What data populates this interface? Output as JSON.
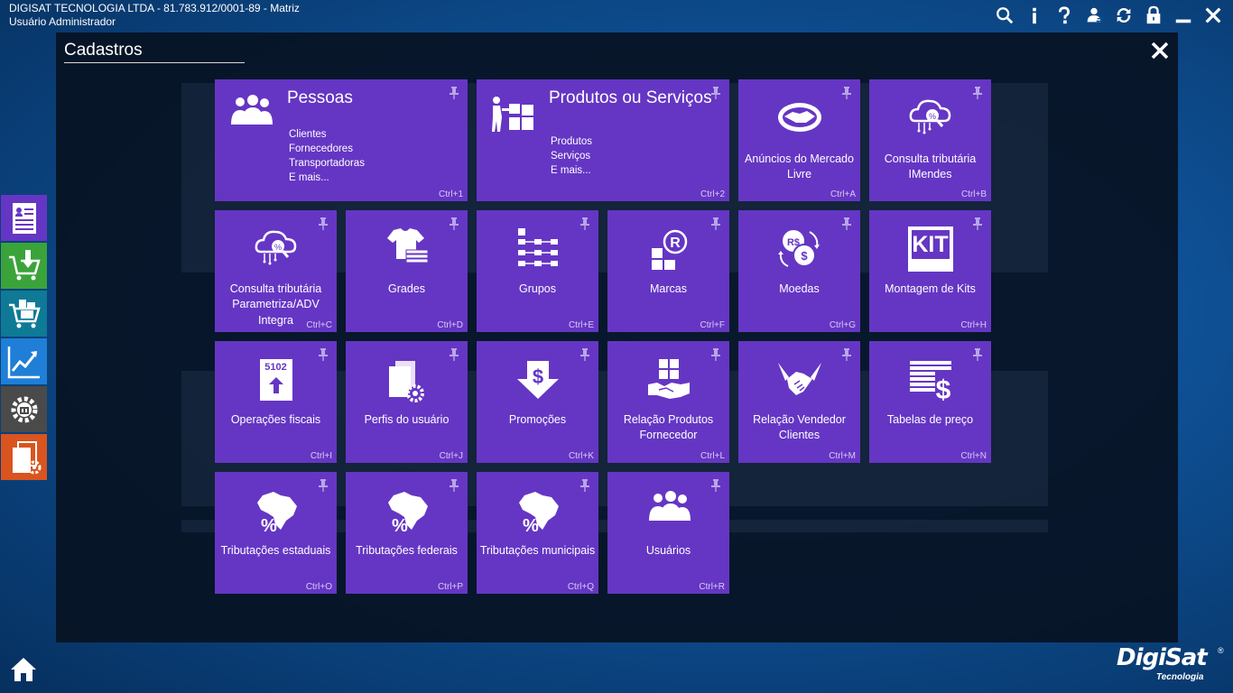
{
  "header": {
    "company": "DIGISAT TECNOLOGIA LTDA - 81.783.912/0001-89 - Matriz",
    "user": "Usuário Administrador"
  },
  "top_icons": [
    "search-icon",
    "info-icon",
    "help-icon",
    "user-switch-icon",
    "sync-icon",
    "lock-icon",
    "minimize-icon",
    "close-icon"
  ],
  "sidebar": [
    "cadastro-icon",
    "entrada-icon",
    "vendas-icon",
    "relatorios-icon",
    "configuracoes-icon",
    "documentos-icon"
  ],
  "sidebar_colors": [
    "#6536c4",
    "#3aa33a",
    "#0e7a96",
    "#1f7fd6",
    "#4a4a4a",
    "#d9541e"
  ],
  "dialog": {
    "title": "Cadastros"
  },
  "tiles": {
    "pessoas": {
      "title": "Pessoas",
      "lines": [
        "Clientes",
        "Fornecedores",
        "Transportadoras",
        "E mais..."
      ],
      "shortcut": "Ctrl+1"
    },
    "produtos": {
      "title": "Produtos ou Serviços",
      "lines": [
        "Produtos",
        "Serviços",
        "E mais..."
      ],
      "shortcut": "Ctrl+2"
    },
    "anuncios": {
      "label": "Anúncios do Mercado Livre",
      "shortcut": "Ctrl+A"
    },
    "imendes": {
      "label": "Consulta tributária IMendes",
      "shortcut": "Ctrl+B"
    },
    "parametriza": {
      "label1": "Consulta tributária",
      "label2": "Parametriza/ADV",
      "label3": "Integra",
      "shortcut": "Ctrl+C"
    },
    "grades": {
      "label": "Grades",
      "shortcut": "Ctrl+D"
    },
    "grupos": {
      "label": "Grupos",
      "shortcut": "Ctrl+E"
    },
    "marcas": {
      "label": "Marcas",
      "shortcut": "Ctrl+F"
    },
    "moedas": {
      "label": "Moedas",
      "shortcut": "Ctrl+G"
    },
    "kits": {
      "label": "Montagem de Kits",
      "shortcut": "Ctrl+H"
    },
    "operacoes": {
      "label": "Operações fiscais",
      "shortcut": "Ctrl+I"
    },
    "perfis": {
      "label": "Perfis do usuário",
      "shortcut": "Ctrl+J"
    },
    "promocoes": {
      "label": "Promoções",
      "shortcut": "Ctrl+K"
    },
    "relprod": {
      "label1": "Relação Produtos",
      "label2": "Fornecedor",
      "shortcut": "Ctrl+L"
    },
    "relvend": {
      "label1": "Relação Vendedor",
      "label2": "Clientes",
      "shortcut": "Ctrl+M"
    },
    "tabelas": {
      "label": "Tabelas de preço",
      "shortcut": "Ctrl+N"
    },
    "trib_est": {
      "label": "Tributações estaduais",
      "shortcut": "Ctrl+O"
    },
    "trib_fed": {
      "label": "Tributações federais",
      "shortcut": "Ctrl+P"
    },
    "trib_mun": {
      "label": "Tributações municipais",
      "shortcut": "Ctrl+Q"
    },
    "usuarios": {
      "label": "Usuários",
      "shortcut": "Ctrl+R"
    }
  },
  "kit_text": "KIT",
  "operacoes_code": "5102",
  "logo": {
    "line1": "DigiSat",
    "line2": "Tecnologia",
    "reg": "®"
  }
}
